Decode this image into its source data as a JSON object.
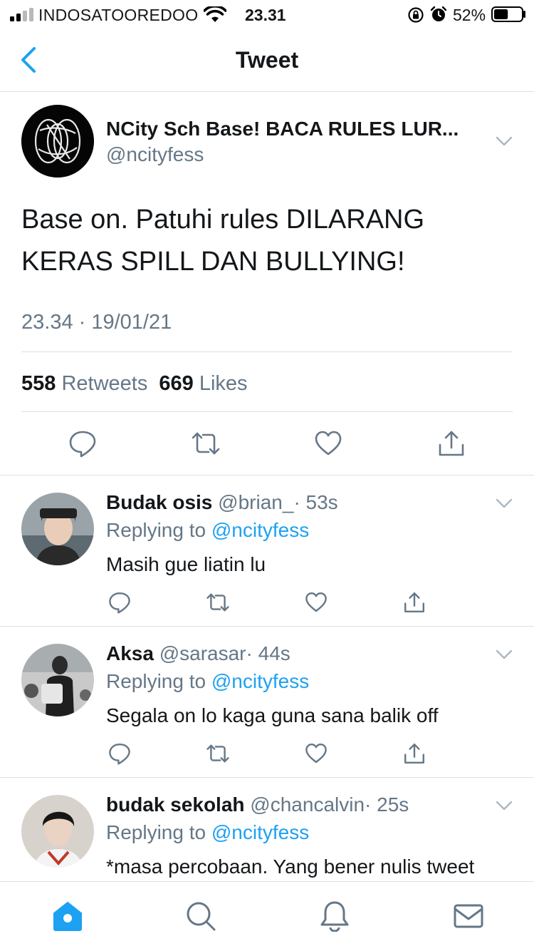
{
  "status_bar": {
    "carrier": "INDOSATOOREDOO",
    "time": "23.31",
    "battery_percent": "52%",
    "battery_level": 0.52
  },
  "nav": {
    "title": "Tweet",
    "back_icon": "chevron-left-icon"
  },
  "main_tweet": {
    "name": "NCity Sch Base! BACA RULES LUR...",
    "handle": "@ncityfess",
    "text_line1": "Base on. Patuhi rules DILARANG",
    "text_line2": "KERAS SPILL DAN BULLYING!",
    "timestamp": "23.34 · 19/01/21",
    "retweets_count": "558",
    "retweets_label": "Retweets",
    "likes_count": "669",
    "likes_label": "Likes",
    "actions": [
      "reply-icon",
      "retweet-icon",
      "like-icon",
      "share-icon"
    ]
  },
  "replies": [
    {
      "name": "Budak osis",
      "handle": "@brian_",
      "time": "· 53s",
      "replying_prefix": "Replying to",
      "replying_to": "@ncityfess",
      "text": "Masih gue liatin lu"
    },
    {
      "name": "Aksa",
      "handle": "@sarasar",
      "time": "· 44s",
      "replying_prefix": "Replying to",
      "replying_to": "@ncityfess",
      "text": "Segala on lo kaga guna sana balik off"
    },
    {
      "name": "budak sekolah",
      "handle": "@chancalvin",
      "time": "· 25s",
      "replying_prefix": "Replying to",
      "replying_to": "@ncityfess",
      "text": "*masa percobaan. Yang bener nulis tweet"
    }
  ],
  "tab_bar": {
    "tabs": [
      "home-icon",
      "search-icon",
      "notifications-icon",
      "messages-icon"
    ],
    "active": "home-icon"
  },
  "colors": {
    "accent": "#1da1f2",
    "secondary_text": "#657786",
    "primary_text": "#14171a",
    "divider": "#dcdfe2"
  }
}
